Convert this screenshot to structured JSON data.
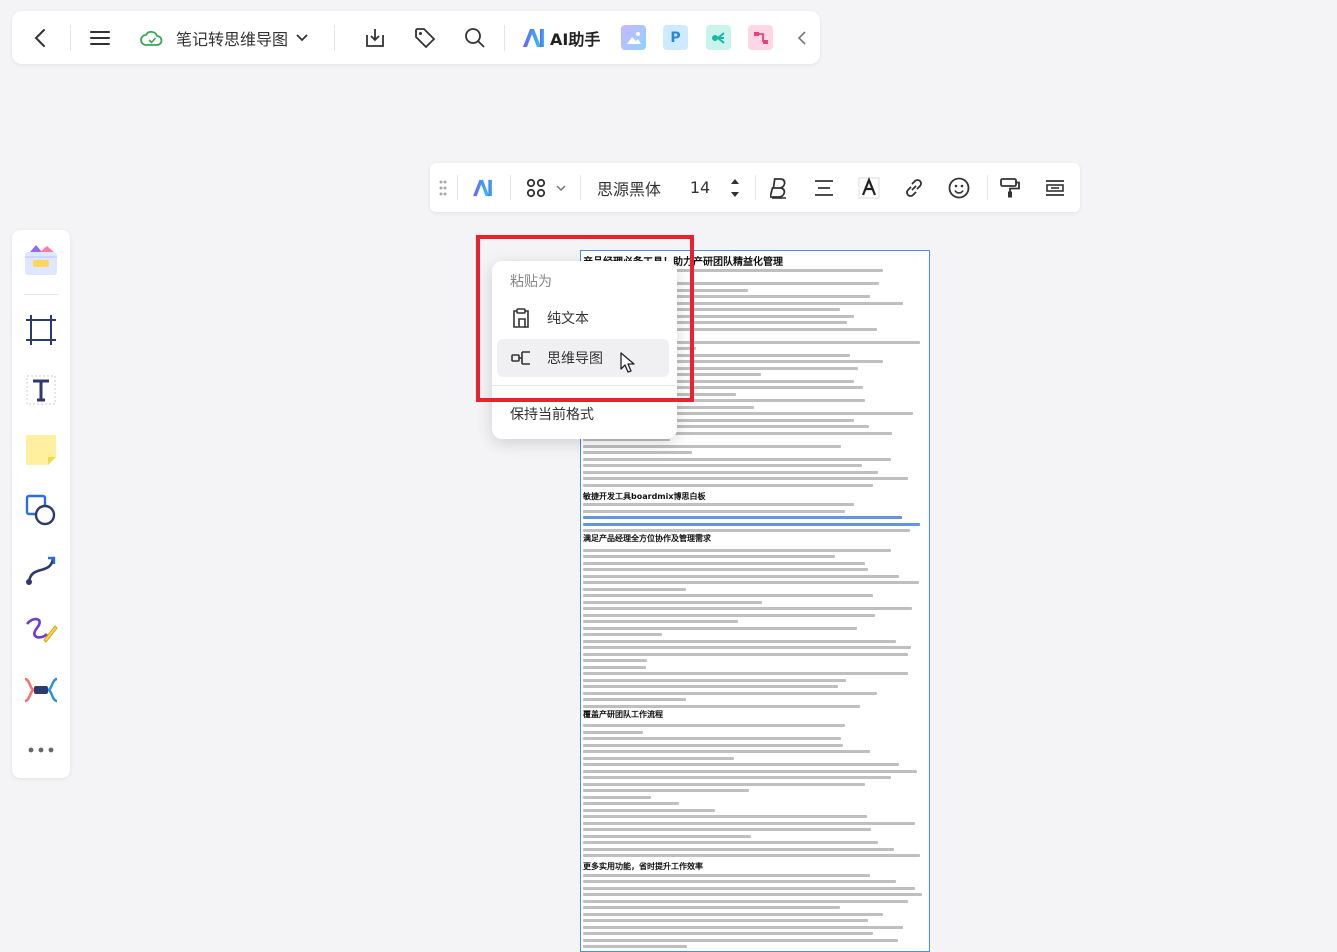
{
  "topbar": {
    "doc_title": "笔记转思维导图",
    "ai_label": "AI助手",
    "app_p_letter": "P"
  },
  "format_bar": {
    "font_family": "思源黑体",
    "font_size": "14"
  },
  "paste_menu": {
    "header": "粘贴为",
    "items": [
      {
        "label": "纯文本"
      },
      {
        "label": "思维导图"
      }
    ],
    "keep_format": "保持当前格式"
  },
  "document": {
    "headings": [
      "产品经理必备工具！助力产研团队精益化管理",
      "敏捷开发工具boardmix博思白板",
      "满足产品经理全方位协作及管理需求",
      "覆盖产研团队工作流程",
      "更多实用功能，省时提升工作效率"
    ]
  },
  "colors": {
    "highlight": "#e8232d",
    "selection": "#4a90e2"
  }
}
